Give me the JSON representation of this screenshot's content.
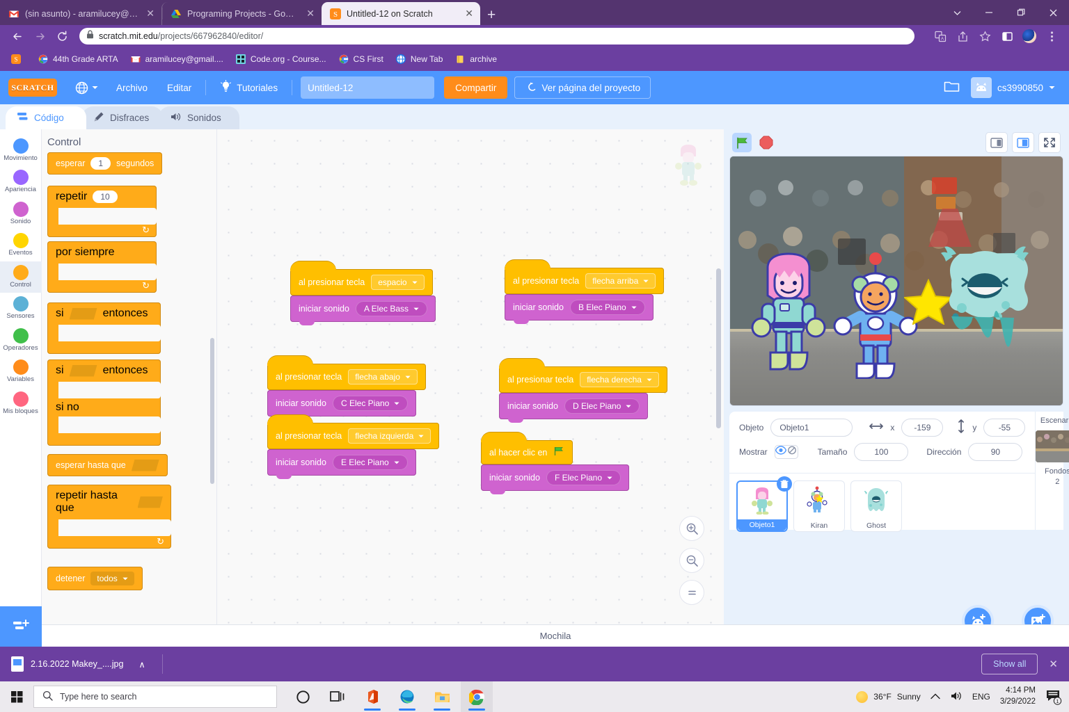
{
  "browser": {
    "tabs": [
      {
        "label": "(sin asunto) - aramilucey@gmail...",
        "icon": "gmail-icon",
        "active": false
      },
      {
        "label": "Programing Projects - Google Dr",
        "icon": "gdrive-icon",
        "active": false
      },
      {
        "label": "Untitled-12 on Scratch",
        "icon": "scratch-icon",
        "active": true
      }
    ],
    "new_tab_label": "+",
    "close_label": "✕",
    "window_controls": {
      "chevron": "⌄",
      "minimize": "—",
      "maximize": "❐",
      "close": "✕"
    },
    "nav": {
      "back": "←",
      "forward": "→",
      "reload": "⟳"
    },
    "url_secure": "scratch.mit.edu",
    "url_path": "/projects/667962840/editor/",
    "bookmarks": [
      {
        "label": "",
        "icon": "scratch-icon"
      },
      {
        "label": "44th Grade ARTA",
        "icon": "google-icon"
      },
      {
        "label": "aramilucey@gmail....",
        "icon": "gmail-icon"
      },
      {
        "label": "Code.org - Course...",
        "icon": "codeorg-icon"
      },
      {
        "label": "CS First",
        "icon": "google-icon"
      },
      {
        "label": "New Tab",
        "icon": "globe-icon"
      },
      {
        "label": "archive",
        "icon": "folder-icon"
      }
    ]
  },
  "scratch": {
    "logo_text": "SCRATCH",
    "menu": {
      "language_label": "",
      "file": "Archivo",
      "edit": "Editar",
      "tutorials": "Tutoriales",
      "project_title": "Untitled-12",
      "share": "Compartir",
      "see_project_page": "Ver página del proyecto",
      "username": "cs3990850"
    },
    "tabs": [
      {
        "label": "Código",
        "icon": "code-icon",
        "active": true
      },
      {
        "label": "Disfraces",
        "icon": "brush-icon",
        "active": false
      },
      {
        "label": "Sonidos",
        "icon": "speaker-icon",
        "active": false
      }
    ],
    "categories": [
      {
        "label": "Movimiento",
        "color": "#4c97ff",
        "selected": false
      },
      {
        "label": "Apariencia",
        "color": "#9966ff",
        "selected": false
      },
      {
        "label": "Sonido",
        "color": "#cf63cf",
        "selected": false
      },
      {
        "label": "Eventos",
        "color": "#ffd500",
        "selected": false
      },
      {
        "label": "Control",
        "color": "#ffab19",
        "selected": true
      },
      {
        "label": "Sensores",
        "color": "#5cb1d6",
        "selected": false
      },
      {
        "label": "Operadores",
        "color": "#40bf4a",
        "selected": false
      },
      {
        "label": "Variables",
        "color": "#ff8c1a",
        "selected": false
      },
      {
        "label": "Mis bloques",
        "color": "#ff6680",
        "selected": false
      }
    ],
    "add_extension_label": "Agregar extensión",
    "palette": {
      "title": "Control",
      "blocks": [
        {
          "type": "stack",
          "parts": [
            "esperar",
            "1",
            "segundos"
          ]
        },
        {
          "type": "c",
          "parts": [
            "repetir",
            "10"
          ]
        },
        {
          "type": "c",
          "parts": [
            "por siempre"
          ]
        },
        {
          "type": "c",
          "parts": [
            "si",
            "",
            "entonces"
          ]
        },
        {
          "type": "c-else",
          "parts": [
            "si",
            "",
            "entonces",
            "si no"
          ]
        },
        {
          "type": "stack",
          "parts": [
            "esperar hasta que",
            ""
          ]
        },
        {
          "type": "c",
          "parts": [
            "repetir hasta que",
            ""
          ]
        },
        {
          "type": "stack-drop",
          "parts": [
            "detener",
            "todos"
          ]
        }
      ],
      "labels": {
        "esperar": "esperar",
        "esperar_value": "1",
        "segundos": "segundos",
        "repetir": "repetir",
        "repetir_value": "10",
        "por_siempre": "por siempre",
        "si": "si",
        "entonces": "entonces",
        "si_no": "si no",
        "esperar_hasta_que": "esperar hasta que",
        "repetir_hasta_que": "repetir hasta que",
        "detener": "detener",
        "detener_value": "todos"
      }
    },
    "scripts": [
      {
        "id": "s1",
        "hat_label": "al presionar tecla",
        "hat_value": "espacio",
        "sound_label": "iniciar sonido",
        "sound_value": "A Elec Bass"
      },
      {
        "id": "s2",
        "hat_label": "al presionar tecla",
        "hat_value": "flecha arriba",
        "sound_label": "iniciar sonido",
        "sound_value": "B Elec Piano"
      },
      {
        "id": "s3",
        "hat_label": "al presionar tecla",
        "hat_value": "flecha abajo",
        "sound_label": "iniciar sonido",
        "sound_value": "C Elec Piano"
      },
      {
        "id": "s4",
        "hat_label": "al presionar tecla",
        "hat_value": "flecha derecha",
        "sound_label": "iniciar sonido",
        "sound_value": "D Elec Piano"
      },
      {
        "id": "s5",
        "hat_label": "al presionar tecla",
        "hat_value": "flecha izquierda",
        "sound_label": "iniciar sonido",
        "sound_value": "E Elec Piano"
      },
      {
        "id": "s6",
        "hat_label": "al hacer clic en",
        "hat_value": "",
        "sound_label": "iniciar sonido",
        "sound_value": "F Elec Piano"
      }
    ],
    "zoom_controls": {
      "zoom_in": "+",
      "zoom_out": "−",
      "reset": "="
    },
    "backpack_label": "Mochila",
    "sprite_panel": {
      "objeto_label": "Objeto",
      "objeto_value": "Objeto1",
      "x_label": "x",
      "x_value": "-159",
      "y_label": "y",
      "y_value": "-55",
      "mostrar_label": "Mostrar",
      "tamano_label": "Tamaño",
      "tamano_value": "100",
      "direccion_label": "Dirección",
      "direccion_value": "90",
      "sprites": [
        {
          "name": "Objeto1",
          "selected": true
        },
        {
          "name": "Kiran",
          "selected": false
        },
        {
          "name": "Ghost",
          "selected": false
        }
      ],
      "stage_label": "Escenario",
      "backdrops_label": "Fondos",
      "backdrops_count": "2"
    }
  },
  "downloads": {
    "filename": "2.16.2022 Makey_....jpg",
    "chevron": "∧",
    "show_all": "Show all",
    "close": "✕"
  },
  "taskbar": {
    "search_placeholder": "Type here to search",
    "weather_temp": "36°F",
    "weather_desc": "Sunny",
    "language": "ENG",
    "time": "4:14 PM",
    "date": "3/29/2022",
    "notification_count": "1"
  }
}
